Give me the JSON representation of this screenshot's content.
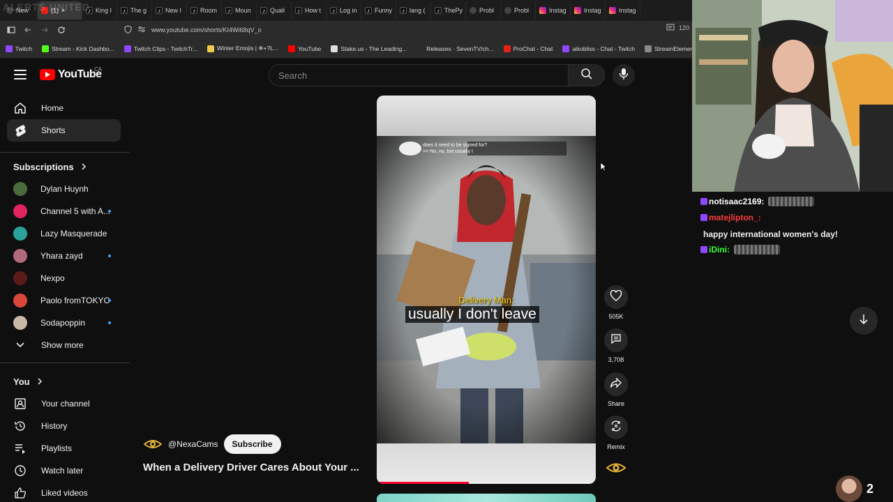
{
  "browser": {
    "watermark": "ALERTS UNITED",
    "tabs": [
      {
        "label": "New",
        "icon": "ph"
      },
      {
        "label": "(1)",
        "icon": "yt",
        "active": true
      },
      {
        "label": "King I",
        "icon": "tiktok"
      },
      {
        "label": "The g",
        "icon": "tiktok"
      },
      {
        "label": "New I",
        "icon": "tiktok"
      },
      {
        "label": "Room",
        "icon": "tiktok"
      },
      {
        "label": "Moun",
        "icon": "tiktok"
      },
      {
        "label": "Quali",
        "icon": "tiktok"
      },
      {
        "label": "How t",
        "icon": "tiktok"
      },
      {
        "label": "Log in",
        "icon": "tiktok"
      },
      {
        "label": "Funny",
        "icon": "tiktok"
      },
      {
        "label": "lang (",
        "icon": "tiktok"
      },
      {
        "label": "ThePy",
        "icon": "tiktok"
      },
      {
        "label": "Probl",
        "icon": "ph"
      },
      {
        "label": "Probl",
        "icon": "ph"
      },
      {
        "label": "Instag",
        "icon": "ig"
      },
      {
        "label": "Instag",
        "icon": "ig"
      },
      {
        "label": "Instag",
        "icon": "ig"
      }
    ],
    "url": "www.youtube.com/shorts/KI4Wi68qV_o",
    "zoom": "120",
    "bookmarks": [
      {
        "label": "Twitch",
        "color": "#9146ff"
      },
      {
        "label": "Stream - Kick Dashbo...",
        "color": "#53fc18"
      },
      {
        "label": "Twitch Clips - TwitchTr...",
        "color": "#9146ff"
      },
      {
        "label": "Winter Emojis | ❄+?L...",
        "color": "#f2c94c"
      },
      {
        "label": "YouTube",
        "color": "#ff0000"
      },
      {
        "label": "Stake.us - The Leading...",
        "color": "#dddddd"
      },
      {
        "label": "Releases · SevenTV/ch...",
        "color": "#2b2b2b"
      },
      {
        "label": "ProChat - Chat",
        "color": "#e62117"
      },
      {
        "label": "aikobliss - Chat - Twitch",
        "color": "#9146ff"
      },
      {
        "label": "StreamElements - Das...",
        "color": "#8a8a8a"
      }
    ]
  },
  "youtube": {
    "logo_text": "YouTube",
    "country": "CA",
    "search_placeholder": "Search",
    "nav": [
      {
        "label": "Home",
        "icon": "home-icon"
      },
      {
        "label": "Shorts",
        "icon": "shorts-icon",
        "active": true
      }
    ],
    "subscriptions_title": "Subscriptions",
    "subscriptions": [
      {
        "label": "Dylan Huynh",
        "color": "#4a6b3a",
        "dot": false
      },
      {
        "label": "Channel 5 with A...",
        "color": "#e0245e",
        "dot": true
      },
      {
        "label": "Lazy Masquerade",
        "color": "#2aa39a",
        "dot": false
      },
      {
        "label": "Yhara zayd",
        "color": "#b06a7a",
        "dot": true
      },
      {
        "label": "Nexpo",
        "color": "#5a1a1a",
        "dot": false
      },
      {
        "label": "Paolo fromTOKYO",
        "color": "#d8473a",
        "dot": true
      },
      {
        "label": "Sodapoppin",
        "color": "#c9b8a8",
        "dot": true
      }
    ],
    "show_more": "Show more",
    "you_title": "You",
    "you_items": [
      {
        "label": "Your channel",
        "icon": "account-box-icon"
      },
      {
        "label": "History",
        "icon": "history-icon"
      },
      {
        "label": "Playlists",
        "icon": "playlists-icon"
      },
      {
        "label": "Watch later",
        "icon": "clock-icon"
      },
      {
        "label": "Liked videos",
        "icon": "thumbs-up-icon"
      }
    ]
  },
  "short": {
    "doorcam_text": "does it need to be signed for?\n>> No, no, but usually I",
    "caption_speaker": "Delivery Man:",
    "caption_line": "usually I don't leave",
    "progress": 0.42,
    "channel": "@NexaCams",
    "subscribe": "Subscribe",
    "title": "When a Delivery Driver Cares About Your ...",
    "likes": "505K",
    "comments": "3,708",
    "share": "Share",
    "remix": "Remix"
  },
  "chat": {
    "messages": [
      {
        "user": "notisaac2169:",
        "user_color": "#ffffff",
        "text": "",
        "emote": true
      },
      {
        "user": "matejlipton_:",
        "user_color": "#ff3b3b",
        "text": "happy international women's day!",
        "emote": false
      },
      {
        "user": "iDini:",
        "user_color": "#3cff3c",
        "text": "",
        "emote": true
      }
    ],
    "viewer_count": "2"
  }
}
